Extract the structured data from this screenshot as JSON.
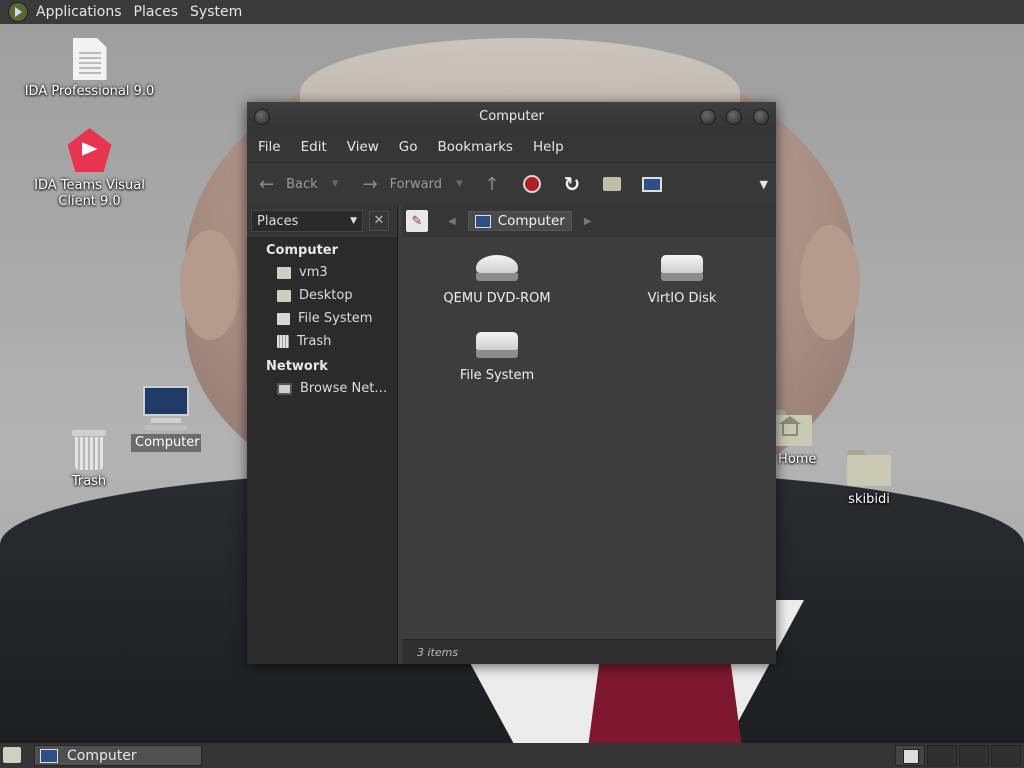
{
  "top_panel": {
    "menus": [
      "Applications",
      "Places",
      "System"
    ]
  },
  "desktop_icons": {
    "ida_pro": "IDA Professional 9.0",
    "ida_teams_line1": "IDA Teams Visual",
    "ida_teams_line2": "Client 9.0",
    "computer": "Computer",
    "trash": "Trash",
    "home": "'s Home",
    "skibidi": "skibidi"
  },
  "window": {
    "title": "Computer",
    "menus": [
      "File",
      "Edit",
      "View",
      "Go",
      "Bookmarks",
      "Help"
    ],
    "toolbar": {
      "back": "Back",
      "forward": "Forward"
    },
    "sidebar": {
      "combo": "Places",
      "sections": {
        "computer": "Computer",
        "network": "Network"
      },
      "items": [
        "vm3",
        "Desktop",
        "File System",
        "Trash",
        "Browse Net…"
      ]
    },
    "location": "Computer",
    "items": [
      "QEMU DVD-ROM",
      "VirtIO Disk",
      "File System"
    ],
    "status": "3 items"
  },
  "taskbar": {
    "task": "Computer"
  }
}
